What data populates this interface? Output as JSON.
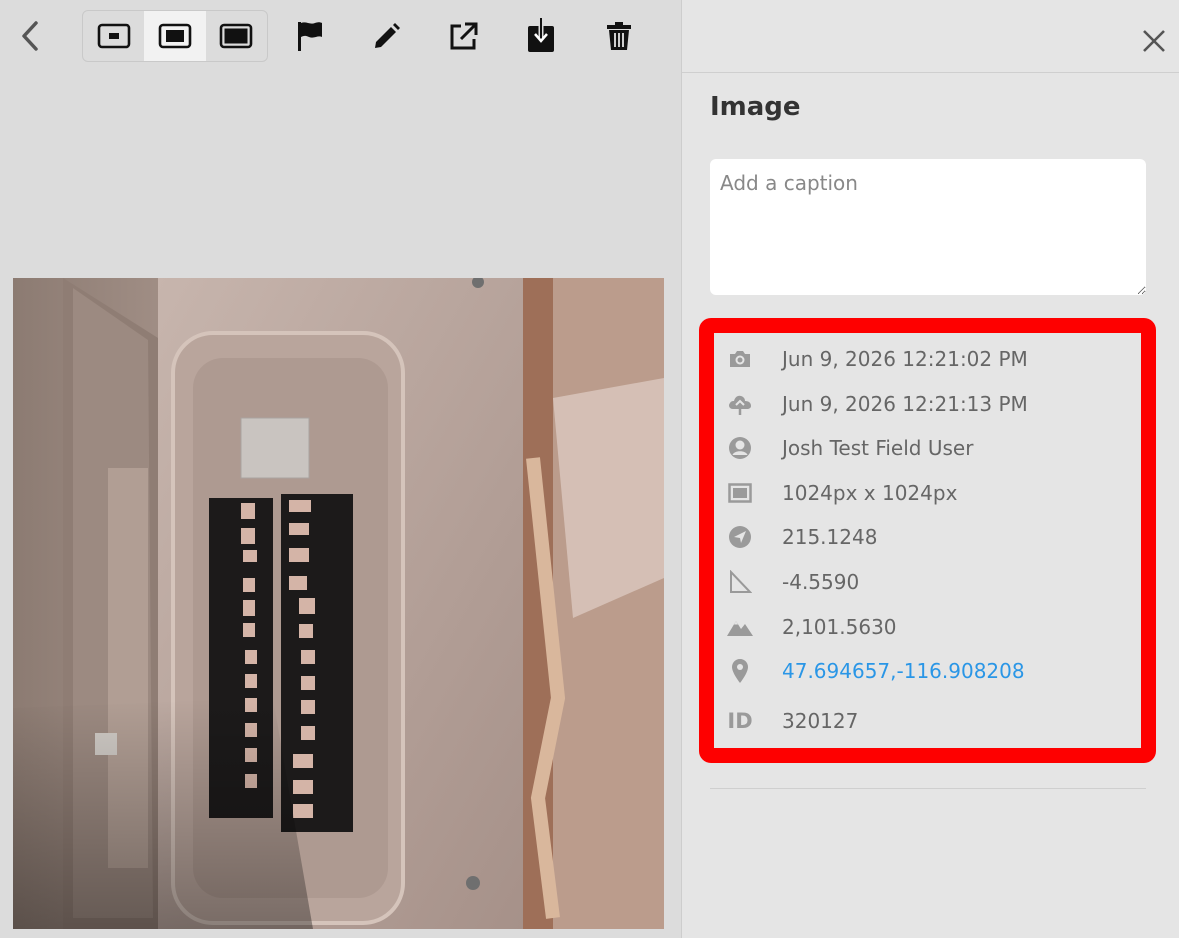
{
  "toolbar": {
    "icons": [
      "chevron-left-icon",
      "small-size-icon",
      "medium-size-icon",
      "large-size-icon",
      "flag-icon",
      "pencil-icon",
      "share-icon",
      "download-icon",
      "trash-icon"
    ],
    "active_size": "medium"
  },
  "panel": {
    "title": "Image",
    "caption_placeholder": "Add a caption",
    "caption_value": ""
  },
  "metadata": {
    "captured": "Jun 9, 2026 12:21:02 PM",
    "uploaded": "Jun 9, 2026 12:21:13 PM",
    "user": "Josh Test Field User",
    "dimensions": "1024px x 1024px",
    "heading": "215.1248",
    "tilt": "-4.5590",
    "altitude": "2,101.5630",
    "coordinates": "47.694657,-116.908208",
    "id_label": "ID",
    "id": "320127"
  },
  "colors": {
    "highlight": "#fe0000",
    "link": "#2a96e6",
    "panel_bg": "#e5e5e5",
    "viewer_bg": "#dcdcdc"
  }
}
